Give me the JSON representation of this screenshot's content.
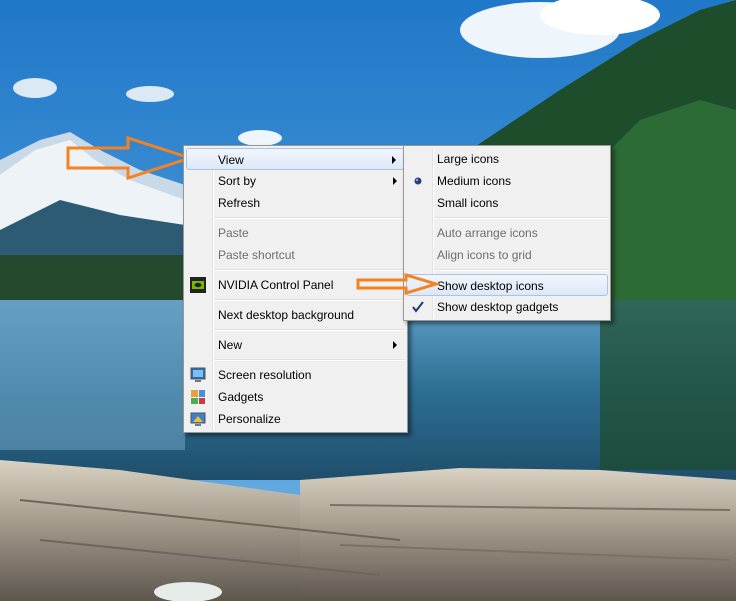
{
  "context_menu": {
    "items": [
      {
        "label": "View"
      },
      {
        "label": "Sort by"
      },
      {
        "label": "Refresh"
      },
      {
        "label": "Paste"
      },
      {
        "label": "Paste shortcut"
      },
      {
        "label": "NVIDIA Control Panel"
      },
      {
        "label": "Next desktop background"
      },
      {
        "label": "New"
      },
      {
        "label": "Screen resolution"
      },
      {
        "label": "Gadgets"
      },
      {
        "label": "Personalize"
      }
    ]
  },
  "view_submenu": {
    "items": [
      {
        "label": "Large icons"
      },
      {
        "label": "Medium icons"
      },
      {
        "label": "Small icons"
      },
      {
        "label": "Auto arrange icons"
      },
      {
        "label": "Align icons to grid"
      },
      {
        "label": "Show desktop icons"
      },
      {
        "label": "Show desktop gadgets"
      }
    ]
  },
  "colors": {
    "arrow_orange": "#f58220",
    "highlight_border": "#a8c4e6",
    "menu_bg": "#f0f0f0"
  }
}
